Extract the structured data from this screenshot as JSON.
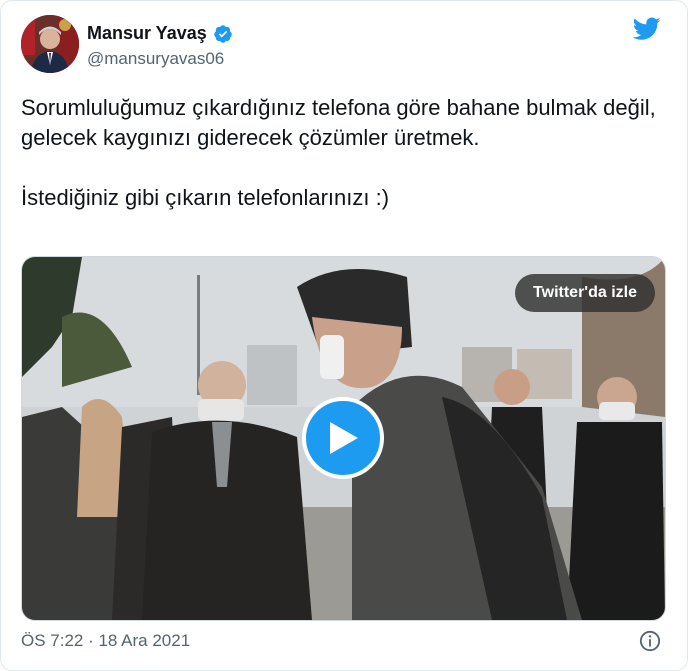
{
  "author": {
    "name": "Mansur Yavaş",
    "handle": "@mansuryavas06"
  },
  "tweet": {
    "text": "Sorumluluğumuz çıkardığınız telefona göre bahane bulmak değil, gelecek kaygınızı giderecek çözümler üretmek.\n\nİstediğiniz gibi çıkarın telefonlarınızı :)"
  },
  "media": {
    "watch_label": "Twitter'da izle"
  },
  "footer": {
    "timestamp": "ÖS 7:22 · 18 Ara 2021"
  },
  "icons": {
    "verified": "verified-badge-icon",
    "logo": "twitter-bird-icon",
    "play": "play-icon",
    "info": "info-icon"
  },
  "colors": {
    "accent": "#1d9bf0",
    "text": "#0f1419",
    "secondary": "#536471"
  }
}
